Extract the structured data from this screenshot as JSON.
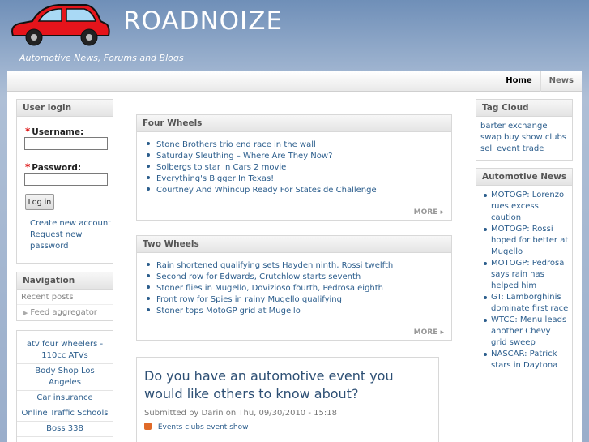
{
  "site": {
    "name": "ROADNOIZE",
    "slogan": "Automotive News, Forums and Blogs",
    "logo_icon": "red-car-icon"
  },
  "primary_links": [
    {
      "label": "Home",
      "active": true
    },
    {
      "label": "News",
      "active": false
    }
  ],
  "login": {
    "title": "User login",
    "username_label": "Username:",
    "password_label": "Password:",
    "username_value": "",
    "password_value": "",
    "submit": "Log in",
    "create_account": "Create new account",
    "request_password_1": "Request new",
    "request_password_2": "password"
  },
  "navigation": {
    "title": "Navigation",
    "items": [
      "Recent posts",
      "Feed aggregator"
    ]
  },
  "ad_links": [
    "atv four wheelers - 110cc ATVs",
    "Body Shop Los Angeles",
    "Car insurance",
    "Online Traffic Schools",
    "Boss 338"
  ],
  "four_wheels": {
    "title": "Four Wheels",
    "items": [
      "Stone Brothers trio end race in the wall",
      "Saturday Sleuthing – Where Are They Now?",
      "Solbergs to star in Cars 2 movie",
      "Everything's Bigger In Texas!",
      "Courtney And Whincup Ready For Stateside Challenge"
    ],
    "more": "MORE ▸"
  },
  "two_wheels": {
    "title": "Two Wheels",
    "items": [
      "Rain shortened qualifying sets Hayden ninth, Rossi twelfth",
      "Second row for Edwards, Crutchlow starts seventh",
      "Stoner flies in Mugello, Dovizioso fourth, Pedrosa eighth",
      "Front row for Spies in rainy Mugello qualifying",
      "Stoner tops MotoGP grid at Mugello"
    ],
    "more": "MORE ▸"
  },
  "node": {
    "title": "Do you have an automotive event you would like others to know about?",
    "submitted": "Submitted by Darin on Thu, 09/30/2010 - 15:18",
    "tags": [
      "Events",
      "clubs",
      "event",
      "show"
    ]
  },
  "tag_cloud": {
    "title": "Tag Cloud",
    "text": "barter exchange swap buy show clubs sell event trade"
  },
  "automotive_news": {
    "title": "Automotive News",
    "items": [
      "MOTOGP: Lorenzo rues excess caution",
      "MOTOGP: Rossi hoped for better at Mugello",
      "MOTOGP: Pedrosa says rain has helped him",
      "GT: Lamborghinis dominate first race",
      "WTCC: Menu leads another Chevy grid sweep",
      "NASCAR: Patrick stars in Daytona"
    ]
  }
}
